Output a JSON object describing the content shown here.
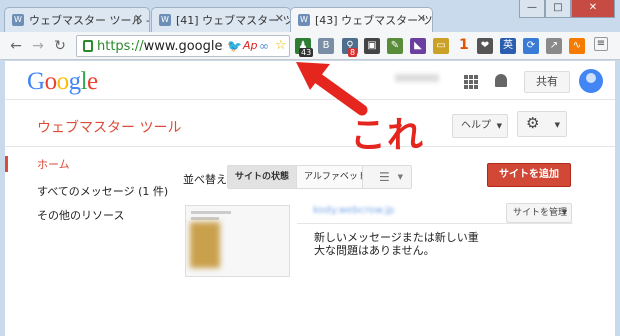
{
  "tabs": [
    {
      "label": "ウェブマスター ツール -",
      "active": false
    },
    {
      "label": "[41] ウェブマスター ツー",
      "active": false
    },
    {
      "label": "[43] ウェブマスター ツー",
      "active": true
    }
  ],
  "window_controls": [
    "—",
    "□",
    "✕"
  ],
  "omnibox": {
    "scheme": "https://",
    "host": "www.google.co"
  },
  "extension_badges": {
    "green_ext": "43",
    "red_ext": "8",
    "counter": "1"
  },
  "header": {
    "logo": "Google",
    "share_label": "共有"
  },
  "webmaster": {
    "title": "ウェブマスター ツール",
    "help_label": "ヘルプ",
    "nav_items": [
      "ホーム",
      "すべてのメッセージ (1 件)",
      "その他のリソース"
    ],
    "sort_label": "並べ替え:",
    "sort_options": [
      "サイトの状態",
      "アルファベット順"
    ],
    "add_site_label": "サイトを追加",
    "manage_site_label": "サイトを管理",
    "site_url": "kody.webcrow.jp",
    "message": "新しいメッセージまたは新しい重大な問題はありません。"
  },
  "annotation": {
    "text": "これ"
  },
  "colors": {
    "accent_red": "#dd4b39",
    "arrow_red": "#e5261f",
    "add_button": "#d14836"
  }
}
